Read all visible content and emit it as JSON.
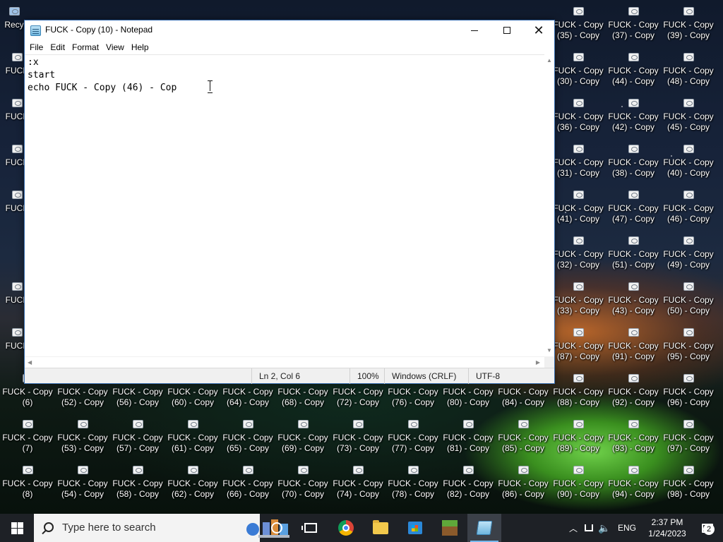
{
  "desktop": {
    "recycle_bin_label": "Recy",
    "left_partial_labels": [
      "FUCK",
      "FUCK",
      "FUCK",
      "FUCK",
      "FU",
      "FUCK",
      "FUCK"
    ],
    "right_icons": [
      [
        "FUCK - Copy\n(35) - Copy",
        "FUCK - Copy\n(37) - Copy",
        "FUCK - Copy\n(39) - Copy"
      ],
      [
        "FUCK - Copy\n(30) - Copy",
        "FUCK - Copy\n(44) - Copy",
        "FUCK - Copy\n(48) - Copy"
      ],
      [
        "FUCK - Copy\n(36) - Copy",
        "FUCK - Copy\n(42) - Copy",
        "FUCK - Copy\n(45) - Copy"
      ],
      [
        "FUCK - Copy\n(31) - Copy",
        "FUCK - Copy\n(38) - Copy",
        "FUCK - Copy\n(40) - Copy"
      ],
      [
        "FUCK - Copy\n(41) - Copy",
        "FUCK - Copy\n(47) - Copy",
        "FUCK - Copy\n(46) - Copy"
      ],
      [
        "FUCK - Copy\n(32) - Copy",
        "FUCK - Copy\n(51) - Copy",
        "FUCK - Copy\n(49) - Copy"
      ],
      [
        "FUCK - Copy\n(33) - Copy",
        "FUCK - Copy\n(43) - Copy",
        "FUCK - Copy\n(50) - Copy"
      ],
      [
        "FUCK - Copy\n(87) - Copy",
        "FUCK - Copy\n(91) - Copy",
        "FUCK - Copy\n(95) - Copy"
      ]
    ],
    "bottom_rows": [
      [
        "FUCK - Copy\n(6)",
        "FUCK - Copy\n(52) - Copy",
        "FUCK - Copy\n(56) - Copy",
        "FUCK - Copy\n(60) - Copy",
        "FUCK - Copy\n(64) - Copy",
        "FUCK - Copy\n(68) - Copy",
        "FUCK - Copy\n(72) - Copy",
        "FUCK - Copy\n(76) - Copy",
        "FUCK - Copy\n(80) - Copy",
        "FUCK - Copy\n(84) - Copy",
        "FUCK - Copy\n(88) - Copy",
        "FUCK - Copy\n(92) - Copy",
        "FUCK - Copy\n(96) - Copy"
      ],
      [
        "FUCK - Copy\n(7)",
        "FUCK - Copy\n(53) - Copy",
        "FUCK - Copy\n(57) - Copy",
        "FUCK - Copy\n(61) - Copy",
        "FUCK - Copy\n(65) - Copy",
        "FUCK - Copy\n(69) - Copy",
        "FUCK - Copy\n(73) - Copy",
        "FUCK - Copy\n(77) - Copy",
        "FUCK - Copy\n(81) - Copy",
        "FUCK - Copy\n(85) - Copy",
        "FUCK - Copy\n(89) - Copy",
        "FUCK - Copy\n(93) - Copy",
        "FUCK - Copy\n(97) - Copy"
      ],
      [
        "FUCK - Copy\n(8)",
        "FUCK - Copy\n(54) - Copy",
        "FUCK - Copy\n(58) - Copy",
        "FUCK - Copy\n(62) - Copy",
        "FUCK - Copy\n(66) - Copy",
        "FUCK - Copy\n(70) - Copy",
        "FUCK - Copy\n(74) - Copy",
        "FUCK - Copy\n(78) - Copy",
        "FUCK - Copy\n(82) - Copy",
        "FUCK - Copy\n(86) - Copy",
        "FUCK - Copy\n(90) - Copy",
        "FUCK - Copy\n(94) - Copy",
        "FUCK - Copy\n(98) - Copy"
      ]
    ]
  },
  "notepad": {
    "title": "FUCK - Copy (10) - Notepad",
    "menu": [
      "File",
      "Edit",
      "Format",
      "View",
      "Help"
    ],
    "lines": [
      ":x",
      "start",
      "echo FUCK - Copy (46) - Cop"
    ],
    "status": {
      "position": "Ln 2, Col 6",
      "zoom": "100%",
      "line_endings": "Windows (CRLF)",
      "encoding": "UTF-8"
    }
  },
  "taskbar": {
    "search_placeholder": "Type here to search",
    "apps": [
      "cortana-icon",
      "task-view-icon",
      "chrome-icon",
      "file-explorer-icon",
      "store-icon",
      "minecraft-icon",
      "notepad-icon"
    ],
    "tray": {
      "language": "ENG",
      "time": "2:37 PM",
      "date": "1/24/2023",
      "notification_count": "2"
    }
  },
  "colors": {
    "taskbar_bg": "#1e2126",
    "active_indicator": "#76b9ed",
    "window_border": "#3a6fb0"
  }
}
